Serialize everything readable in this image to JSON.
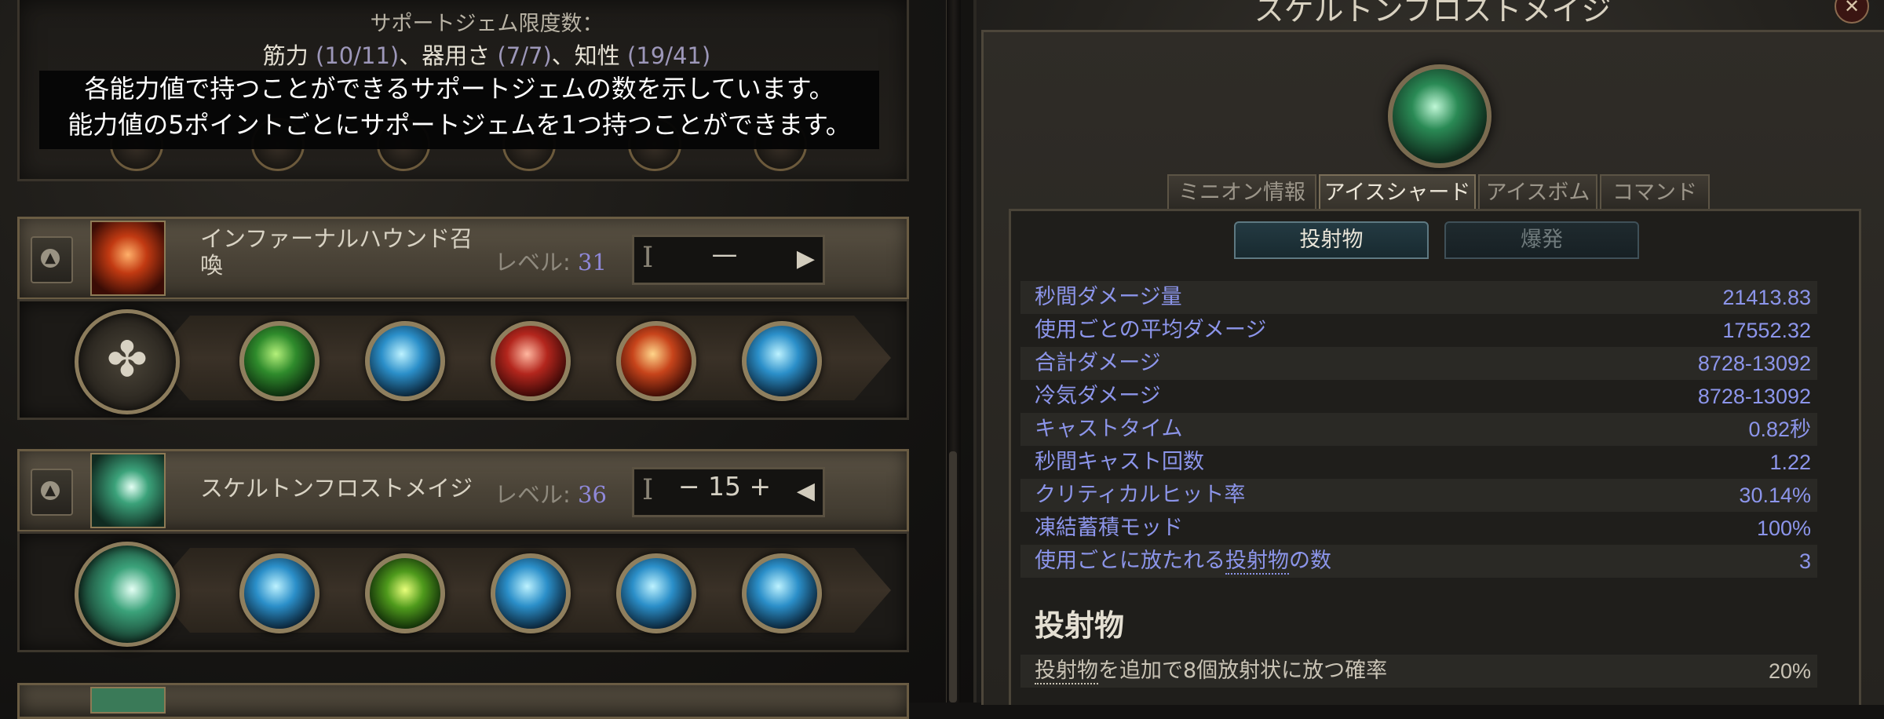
{
  "support_limit": {
    "title": "サポートジェム限度数：",
    "str_label": "筋力",
    "str_val": "(10/11)",
    "dex_label": "、器用さ",
    "dex_val": "(7/7)",
    "int_label": "、知性",
    "int_val": "(19/41)"
  },
  "tooltip": {
    "line1": "各能力値で持つことができるサポートジェムの数を示しています。",
    "line2": "能力値の5ポイントごとにサポートジェムを1つ持つことができます。"
  },
  "skills": [
    {
      "name_line1": "インファーナルハウンド召",
      "name_line2": "喚",
      "level_label": "レベル:",
      "level": "31",
      "control_i": "I",
      "control_value": "—",
      "control_arrow": "▶"
    },
    {
      "name_line1": "スケルトンフロストメイジ",
      "level_label": "レベル:",
      "level": "36",
      "control_i": "I",
      "control_value": "− 15 +",
      "control_arrow": "◀"
    }
  ],
  "icons": {
    "collapse": "▲",
    "main_slot": "✤",
    "close": "✕"
  },
  "panel": {
    "title": "スケルトンフロストメイジ",
    "tabs": [
      "ミニオン情報",
      "アイスシャード",
      "アイスボム",
      "コマンド"
    ],
    "active_tab": "アイスシャード",
    "subtabs": [
      "投射物",
      "爆発"
    ],
    "active_subtab": "投射物"
  },
  "stats": [
    {
      "label": "秒間ダメージ量",
      "value": "21413.83"
    },
    {
      "label": "使用ごとの平均ダメージ",
      "value": "17552.32"
    },
    {
      "label": "合計ダメージ",
      "value": "8728-13092"
    },
    {
      "label": "冷気ダメージ",
      "value": "8728-13092"
    },
    {
      "label": "キャストタイム",
      "value": "0.82秒"
    },
    {
      "label": "秒間キャスト回数",
      "value": "1.22"
    },
    {
      "label": "クリティカルヒット率",
      "value": "30.14%"
    },
    {
      "label": "凍結蓄積モッド",
      "value": "100%"
    },
    {
      "label_pre": "使用ごとに放たれる",
      "label_link": "投射物",
      "label_post": "の数",
      "value": "3"
    }
  ],
  "section": {
    "title": "投射物",
    "effect_link": "投射物",
    "effect_text": "を追加で8個放射状に放つ確率",
    "effect_value": "20%"
  },
  "colors": {
    "stat_text": "#8c95ea",
    "level_number": "#8f88d8",
    "header_bar": "#4a4337"
  }
}
